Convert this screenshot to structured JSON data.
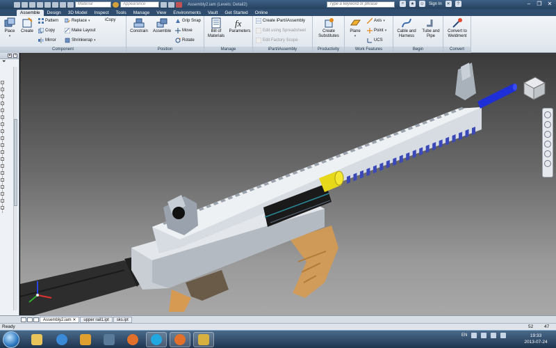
{
  "title_bar": {
    "doc_title": "Assembly2.iam (Levels: Detail2)",
    "material_placeholder": "Material",
    "appearance_placeholder": "Appearance",
    "search_placeholder": "Type a keyword or phrase",
    "sign_in": "Sign In"
  },
  "ribbon_tabs": [
    {
      "label": "Assemble",
      "active": true
    },
    {
      "label": "Design"
    },
    {
      "label": "3D Model"
    },
    {
      "label": "Inspect"
    },
    {
      "label": "Tools"
    },
    {
      "label": "Manage"
    },
    {
      "label": "View"
    },
    {
      "label": "Environments"
    },
    {
      "label": "Vault"
    },
    {
      "label": "Get Started"
    },
    {
      "label": "Online"
    }
  ],
  "ribbon": {
    "component": {
      "label": "Component",
      "place": "Place",
      "create": "Create",
      "pattern": "Pattern",
      "copy": "Copy",
      "mirror": "Mirror",
      "replace": "Replace",
      "make_layout": "Make Layout",
      "shrinkwrap": "Shrinkwrap",
      "icopy": "iCopy"
    },
    "position": {
      "label": "Position",
      "constrain": "Constrain",
      "assemble": "Assemble",
      "grip_snap": "Grip Snap",
      "move": "Move",
      "rotate": "Rotate"
    },
    "manage": {
      "label": "Manage",
      "bill_of_materials": "Bill of Materials",
      "parameters": "Parameters"
    },
    "ipart": {
      "label": "iPart/iAssembly",
      "create_ipart": "Create iPart/iAssembly",
      "edit_spreadsheet": "Edit using Spreadsheet",
      "edit_factory_scope": "Edit Factory Scope"
    },
    "productivity": {
      "label": "Productivity",
      "create_substitutes": "Create Substitutes"
    },
    "work_features": {
      "label": "Work Features",
      "plane": "Plane",
      "axis": "Axis",
      "point": "Point",
      "ucs": "UCS"
    },
    "begin": {
      "label": "Begin",
      "cable_harness": "Cable and Harness",
      "tube_pipe": "Tube and Pipe"
    },
    "convert": {
      "label": "Convert",
      "convert_weldment": "Convert to Weldment"
    }
  },
  "browser": {
    "filter_icon": "filter-icon"
  },
  "doc_tabs": [
    {
      "label": "Assembly2.iam",
      "active": true,
      "closable": true
    },
    {
      "label": "upper rail1.ipt"
    },
    {
      "label": "sks.ipt"
    }
  ],
  "status": {
    "text": "Ready",
    "num1": "52",
    "num2": "47"
  },
  "taskbar": {
    "language": "EN",
    "time": "19:33",
    "date": "2013-07-24"
  },
  "colors": {
    "ribbon_bg": "#e6ebf1",
    "title_bg": "#2f4d6f",
    "viewport_top": "#3a3a3a",
    "viewport_bottom": "#a8a8a8",
    "handguard": "#d6dce2",
    "barrel_blue": "#1e2fd8",
    "bolt_yellow": "#e8d81a",
    "magazine_orange": "#d69a52"
  }
}
